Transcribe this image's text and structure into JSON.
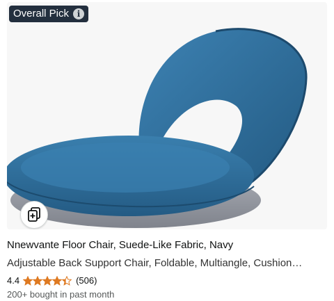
{
  "badge": {
    "label": "Overall Pick",
    "icon": "info-icon"
  },
  "product": {
    "title": "Nnewvante Floor Chair, Suede-Like Fabric, Navy",
    "subtitle": "Adjustable Back Support Chair, Foldable, Multiangle, Cushion…",
    "rating": "4.4",
    "stars_value": 4.4,
    "stars_max": 5,
    "review_count": "(506)",
    "bought": "200+ bought in past month"
  },
  "colors": {
    "star": "#de7921",
    "badge_bg": "#232f3e",
    "chair": "#2f6f9e"
  },
  "icons": {
    "compare": "compare-icon",
    "star": "star-icon"
  }
}
